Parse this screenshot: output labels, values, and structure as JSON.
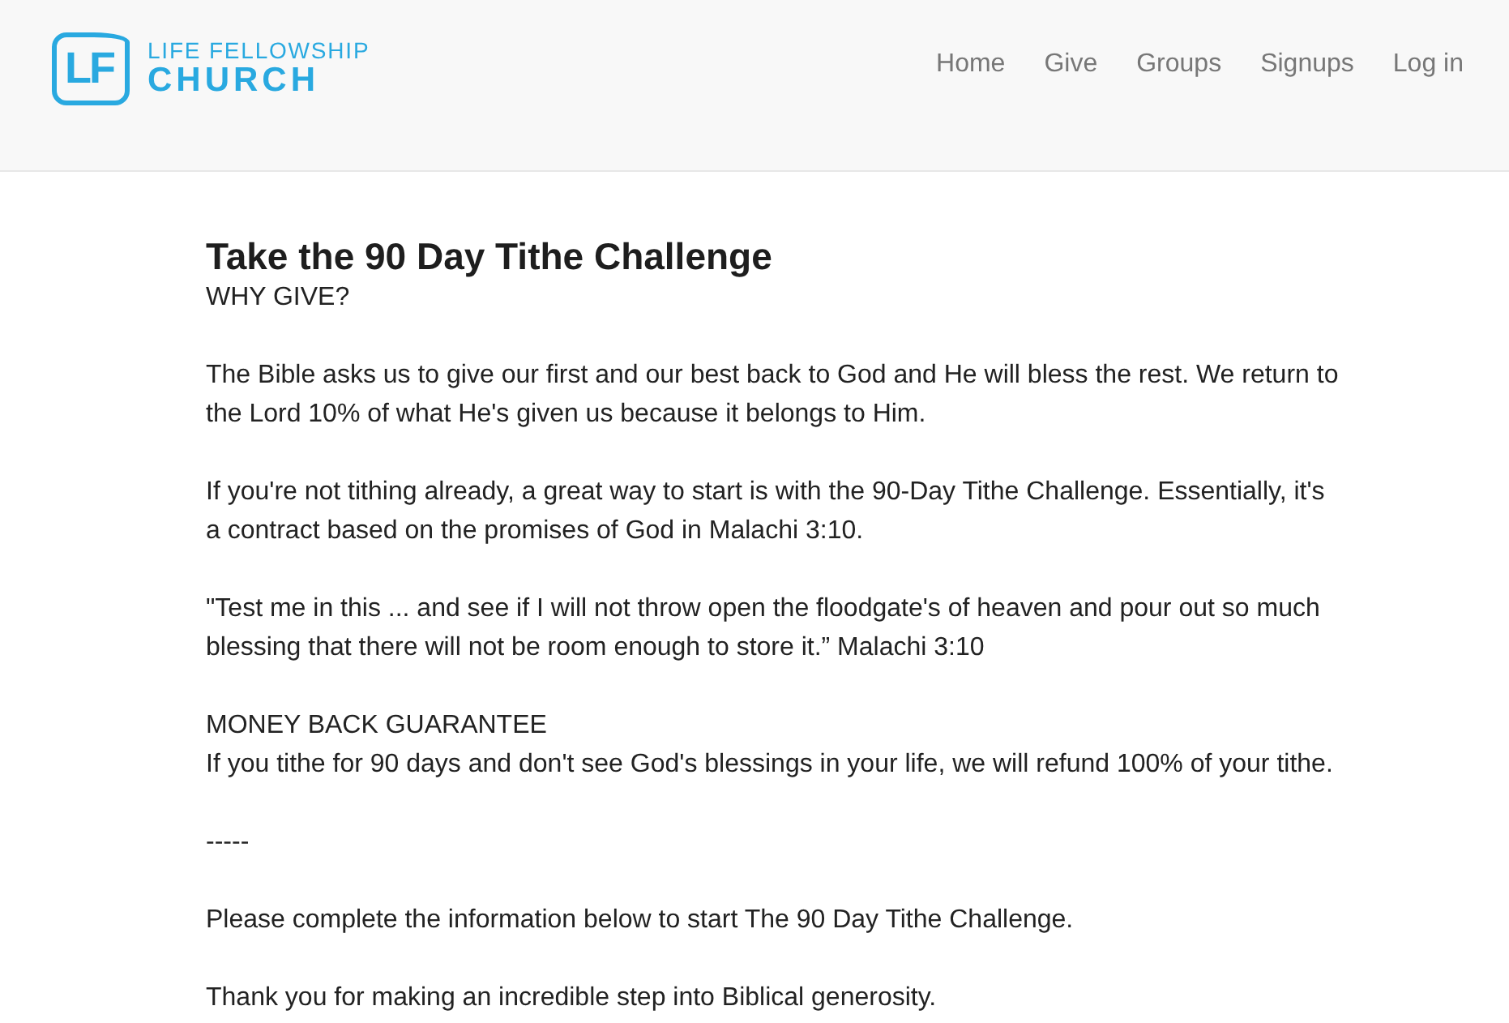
{
  "header": {
    "logo": {
      "monogram": "LF",
      "name_upper": "LIFE FELLOWSHIP",
      "name_lower": "CHURCH"
    },
    "nav": [
      "Home",
      "Give",
      "Groups",
      "Signups",
      "Log in"
    ]
  },
  "article": {
    "title": "Take the 90 Day Tithe Challenge",
    "subtitle": "WHY GIVE?",
    "blocks": [
      {
        "kind": "paragraph",
        "text": "The Bible asks us to give our first and our best back to God and He will bless the rest. We return to the Lord 10% of what He's given us because it belongs to Him."
      },
      {
        "kind": "paragraph",
        "text": "If you're not tithing already, a great way to start is with the 90-Day Tithe Challenge. Essentially, it's a contract based on the promises of God in Malachi 3:10."
      },
      {
        "kind": "paragraph",
        "text": "\"Test me in this ... and see if I will not throw open the floodgate's of heaven and pour out so much blessing that there will not be room enough to store it.” Malachi 3:10"
      },
      {
        "kind": "heading",
        "text": "MONEY BACK GUARANTEE"
      },
      {
        "kind": "paragraph",
        "text": "If you tithe for 90 days and don't see God's blessings in your life, we will refund 100% of your tithe."
      },
      {
        "kind": "paragraph",
        "text": "-----"
      },
      {
        "kind": "paragraph",
        "text": "Please complete the information below to start The 90 Day Tithe Challenge."
      },
      {
        "kind": "paragraph",
        "text": "Thank you for making an incredible step into Biblical generosity."
      }
    ]
  }
}
